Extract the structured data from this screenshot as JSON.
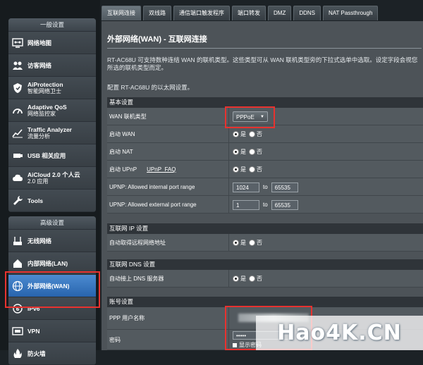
{
  "sidebar": {
    "general_header": "一般设置",
    "general_items": [
      {
        "label": "网络地图",
        "sub": "",
        "icon": "network-map-icon"
      },
      {
        "label": "访客网络",
        "sub": "",
        "icon": "guest-network-icon"
      },
      {
        "label": "AiProtection",
        "sub": "智能网络卫士",
        "icon": "aiprotection-icon"
      },
      {
        "label": "Adaptive QoS",
        "sub": "网络监控家",
        "icon": "qos-icon"
      },
      {
        "label": "Traffic Analyzer",
        "sub": "流量分析",
        "icon": "traffic-analyzer-icon"
      },
      {
        "label": "USB 相关应用",
        "sub": "",
        "icon": "usb-icon"
      },
      {
        "label": "AiCloud 2.0 个人云",
        "sub": "2.0 应用",
        "icon": "aicloud-icon"
      },
      {
        "label": "Tools",
        "sub": "",
        "icon": "wrench-icon"
      }
    ],
    "advanced_header": "高级设置",
    "advanced_items": [
      {
        "label": "无线网络",
        "sub": "",
        "icon": "wireless-icon"
      },
      {
        "label": "内部网络(LAN)",
        "sub": "",
        "icon": "lan-icon"
      },
      {
        "label": "外部网络(WAN)",
        "sub": "",
        "icon": "globe-icon"
      },
      {
        "label": "IPv6",
        "sub": "",
        "icon": "ipv6-icon"
      },
      {
        "label": "VPN",
        "sub": "",
        "icon": "vpn-icon"
      },
      {
        "label": "防火墙",
        "sub": "",
        "icon": "firewall-icon"
      }
    ]
  },
  "tabs": [
    "互联网连接",
    "双线路",
    "通信端口触发程序",
    "端口转发",
    "DMZ",
    "DDNS",
    "NAT Passthrough"
  ],
  "page": {
    "title": "外部网络(WAN) - 互联网连接",
    "desc": "RT-AC68U 可支持数种连结 WAN 的联机类型。这些类型可从 WAN 联机类型旁的下拉式选单中选取。设定字段会视您所选的联机类型而定。",
    "desc2": "配置 RT-AC68U 的以太网设置。"
  },
  "sections": {
    "basic": "基本设置",
    "ip": "互联网 IP 设置",
    "dns": "互联网 DNS 设置",
    "account": "账号设置"
  },
  "fields": {
    "wan_type_label": "WAN 联机类型",
    "wan_type_value": "PPPoE",
    "enable_wan": "启动 WAN",
    "enable_nat": "启动 NAT",
    "enable_upnp": "启动 UPnP",
    "upnp_faq": "UPnP_FAQ",
    "yes": "是",
    "no": "否",
    "internal_range_label": "UPNP: Allowed internal port range",
    "internal_from": "1024",
    "internal_to": "65535",
    "external_range_label": "UPNP: Allowed external port range",
    "external_from": "1",
    "external_to": "65535",
    "to": "to",
    "auto_ip": "自动取得远程网络地址",
    "auto_dns": "自动接上 DNS 服务器",
    "ppp_user": "PPP 用户名称",
    "password": "密码",
    "password_value": "•••••",
    "show_password": "显示密码"
  },
  "watermark": "Hao4K.CN"
}
